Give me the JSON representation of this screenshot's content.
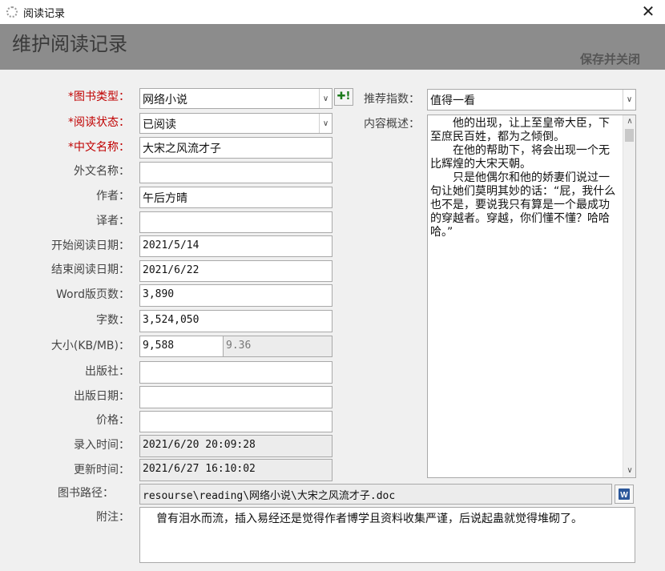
{
  "window": {
    "title": "阅读记录",
    "close_glyph": "✕"
  },
  "header": {
    "title": "维护阅读记录",
    "save_close_label": "保存并关闭"
  },
  "form": {
    "book_type": {
      "label": "*图书类型：",
      "value": "网络小说",
      "add_glyph": "✚!"
    },
    "read_status": {
      "label": "*阅读状态：",
      "value": "已阅读"
    },
    "chinese_name": {
      "label": "*中文名称：",
      "value": "大宋之风流才子"
    },
    "foreign_name": {
      "label": "外文名称：",
      "value": ""
    },
    "author": {
      "label": "作者：",
      "value": "午后方晴"
    },
    "translator": {
      "label": "译者：",
      "value": ""
    },
    "start_date": {
      "label": "开始阅读日期：",
      "value": "2021/5/14"
    },
    "end_date": {
      "label": "结束阅读日期：",
      "value": "2021/6/22"
    },
    "word_pages": {
      "label": "Word版页数：",
      "value": "3,890"
    },
    "word_count": {
      "label": "字数：",
      "value": "3,524,050"
    },
    "size": {
      "label": "大小(KB/MB)：",
      "kb_value": "9,588",
      "mb_value": "9.36"
    },
    "publisher": {
      "label": "出版社：",
      "value": ""
    },
    "publish_date": {
      "label": "出版日期：",
      "value": ""
    },
    "price": {
      "label": "价格：",
      "value": ""
    },
    "entry_time": {
      "label": "录入时间：",
      "value": "2021/6/20 20:09:28"
    },
    "update_time": {
      "label": "更新时间：",
      "value": "2021/6/27 16:10:02"
    },
    "book_path": {
      "label": "图书路径：",
      "value": "resourse\\reading\\网络小说\\大宋之风流才子.doc"
    },
    "notes": {
      "label": "附注：",
      "value": "曾有泪水而流，插入易经还是觉得作者博学且资料收集严谨，后说起蛊就觉得堆砌了。"
    },
    "recommend": {
      "label": "推荐指数：",
      "value": "值得一看"
    },
    "summary": {
      "label": "内容概述：",
      "paragraphs": [
        "他的出现，让上至皇帝大臣，下至庶民百姓，都为之倾倒。",
        "在他的帮助下，将会出现一个无比辉煌的大宋天朝。",
        "只是他偶尔和他的娇妻们说过一句让她们莫明其妙的话：“屁，我什么也不是，要说我只有算是一个最成功的穿越者。穿越，你们懂不懂？哈哈哈。”"
      ]
    }
  },
  "icons": {
    "dropdown": "chevron-down-icon",
    "word": "word-doc-icon",
    "add": "add-icon"
  },
  "colors": {
    "header_bg": "#8c8c8c",
    "required_label": "#c00000",
    "add_icon": "#1a7a1a",
    "word_icon": "#2b579a"
  }
}
